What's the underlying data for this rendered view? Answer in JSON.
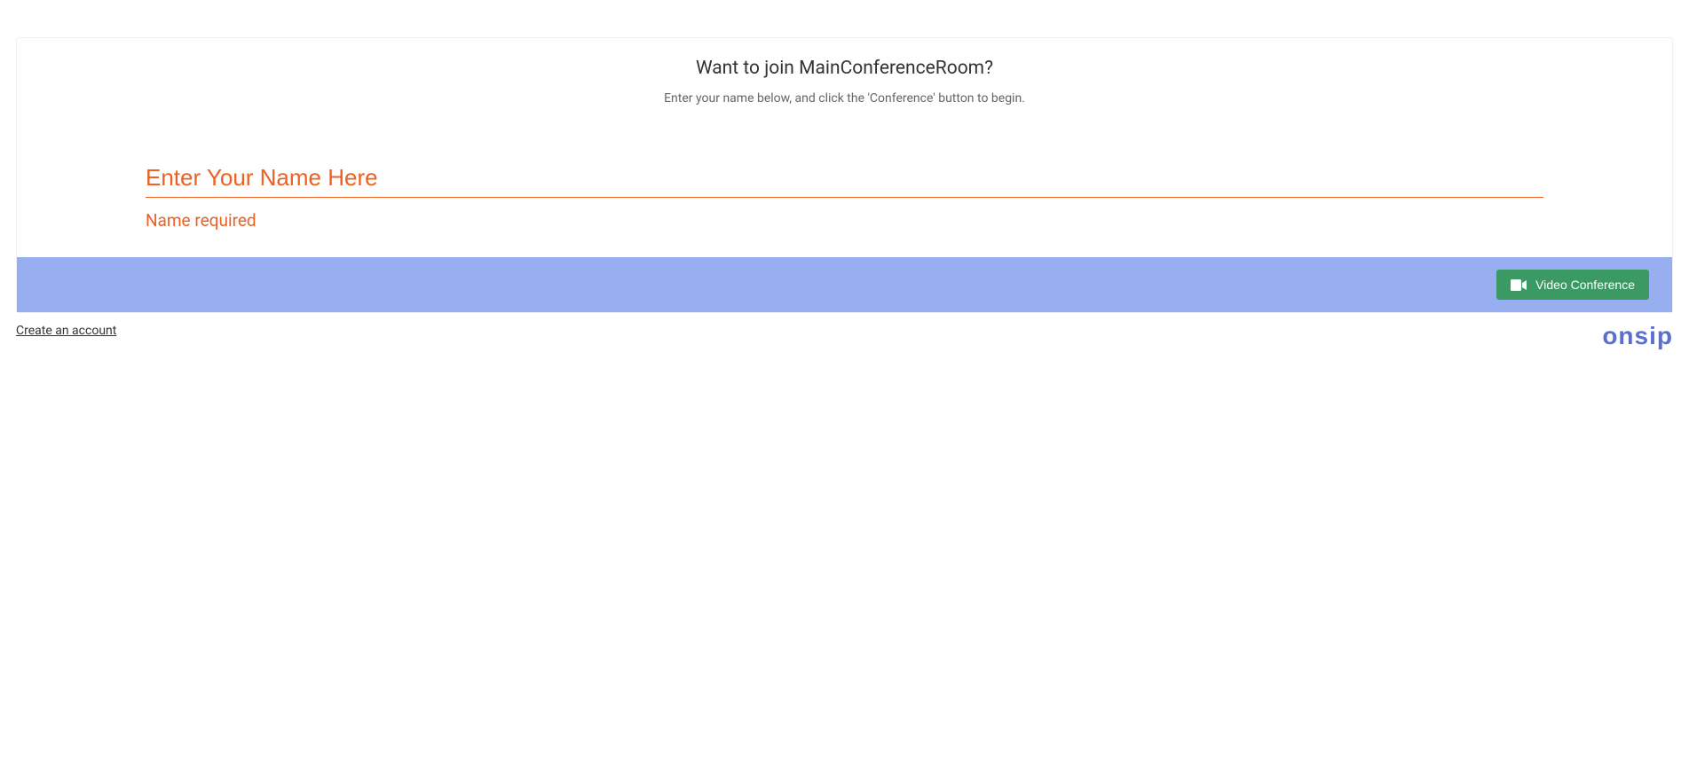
{
  "header": {
    "title": "Want to join MainConferenceRoom?",
    "subtitle": "Enter your name below, and click the 'Conference' button to begin."
  },
  "form": {
    "name_placeholder": "Enter Your Name Here",
    "name_value": "",
    "error_message": "Name required"
  },
  "actions": {
    "conference_button_label": "Video Conference"
  },
  "footer": {
    "create_account_label": "Create an account",
    "logo_text": "onsip"
  },
  "colors": {
    "accent_orange": "#ee6123",
    "bar_blue": "#97aff1",
    "button_green": "#3b9963",
    "logo_blue": "#5a6fd0"
  }
}
